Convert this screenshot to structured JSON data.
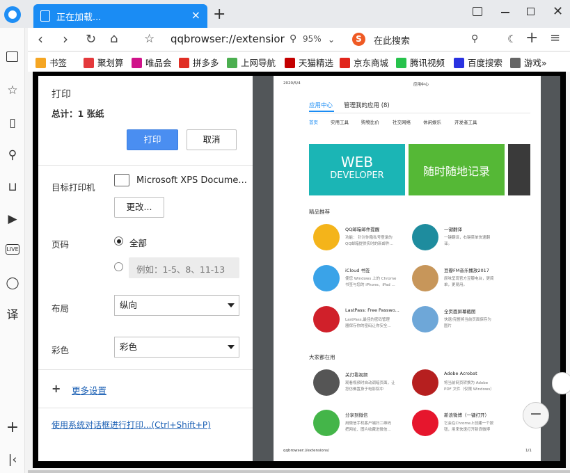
{
  "tab": {
    "title": "正在加载...",
    "close_glyph": "×"
  },
  "nav": {
    "url": "qqbrowser://extensior",
    "zoom": "95%",
    "search_placeholder": "在此搜索",
    "search_engine_glyph": "S"
  },
  "bookmarks": [
    {
      "label": "书签",
      "color": "#f5a623"
    },
    {
      "label": "聚划算",
      "color": "#e4393c"
    },
    {
      "label": "唯品会",
      "color": "#d0138a"
    },
    {
      "label": "拼多多",
      "color": "#e02e24"
    },
    {
      "label": "上网导航",
      "color": "#4caf50"
    },
    {
      "label": "天猫精选",
      "color": "#c40000"
    },
    {
      "label": "京东商城",
      "color": "#e1251b"
    },
    {
      "label": "腾讯视频",
      "color": "#27c24c"
    },
    {
      "label": "百度搜索",
      "color": "#2932e1"
    },
    {
      "label": "游戏»",
      "color": "#666666"
    }
  ],
  "print": {
    "title": "打印",
    "total": "总计：1 张纸",
    "print_button": "打印",
    "cancel_button": "取消",
    "printer_label": "目标打印机",
    "printer_name": "Microsoft XPS Docume...",
    "change_button": "更改...",
    "pages_label": "页码",
    "pages_all": "全部",
    "pages_placeholder": "例如：1-5、8、11-13",
    "layout_label": "布局",
    "layout_value": "纵向",
    "color_label": "彩色",
    "color_value": "彩色",
    "more_settings": "更多设置",
    "system_dialog": "使用系统对话框进行打印...(Ctrl+Shift+P)"
  },
  "page": {
    "date": "2020/5/4",
    "header_title": "应用中心",
    "tab_active": "应用中心",
    "tab_manage": "管理我的应用 (8)",
    "categories": [
      "首页",
      "实用工具",
      "购物比价",
      "社交网络",
      "休闲娱乐",
      "开发者工具"
    ],
    "banner1_line1": "WEB",
    "banner1_line2": "DEVELOPER",
    "banner2": "随时随地记录",
    "section_featured": "精品推荐",
    "apps": [
      {
        "name": "QQ邮箱邮件提醒",
        "desc1": "功能： 针对你隐私号登录的",
        "desc2": "QQ邮箱提供实时的新邮件..."
      },
      {
        "name": "一键翻译",
        "desc1": "一键翻译，右键菜单快速翻",
        "desc2": "译。"
      },
      {
        "name": "iCloud 书签",
        "desc1": "使您 Windows 上的 Chrome",
        "desc2": "书签与您的 iPhone、iPad ..."
      },
      {
        "name": "豆瓣FM音乐播放2017",
        "desc1": "原味呈现官方豆瓣电台，更简",
        "desc2": "单，更易用。"
      },
      {
        "name": "LastPass: Free Passwo...",
        "desc1": "LastPass,最佳的密码管理",
        "desc2": "器保存你的密码让你安全..."
      },
      {
        "name": "全页面屏幕截图",
        "desc1": "快速/完整将当前页面保存为",
        "desc2": "图片"
      }
    ],
    "section_popular": "大家都在用",
    "popular": [
      {
        "name": "关灯看视频",
        "desc1": "观看视频时自动调暗页面，让",
        "desc2": "您仿佛置身于电影院中"
      },
      {
        "name": "Adobe Acrobat",
        "desc1": "将当前网页转换为 Adobe",
        "desc2": "PDF 文件（仅限 Windows）"
      },
      {
        "name": "分享到微信",
        "desc1": "用微信手机客户端扫二维码",
        "desc2": "把网址、图片收藏进微信..."
      },
      {
        "name": "新浪微博（一键打开）",
        "desc1": "它会在Chrome上创建一个按",
        "desc2": "钮，用来快速打开新浪微博"
      }
    ],
    "footer_url": "qqbrowser://extensions/",
    "footer_page": "1/1"
  },
  "colors": {
    "accent": "#1a8cf4",
    "print_button": "#4a8ef1",
    "dialog_frame": "#000000",
    "preview_bg": "#525659"
  }
}
